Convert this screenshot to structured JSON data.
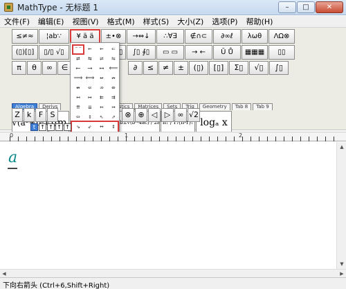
{
  "window": {
    "title": "MathType - 无标题 1",
    "buttons": {
      "minimize": "–",
      "maximize": "□",
      "close": "✕"
    }
  },
  "menu": [
    "文件(F)",
    "编辑(E)",
    "视图(V)",
    "格式(M)",
    "样式(S)",
    "大小(Z)",
    "选项(P)",
    "帮助(H)"
  ],
  "toolbar_row1": [
    "≤≠≈",
    "¦ab∵",
    "¥ ä ä",
    "±•⊗",
    "→⇔↓",
    "∴∀∃",
    "∉∩⊂",
    "∂∞ℓ",
    "λωθ",
    "ΛΩ⊗"
  ],
  "toolbar_row2": [
    "(▯)[▯]",
    "▯/▯ √▯",
    "▯ ▯",
    "Σ▯ Σ▯",
    "∫▯ ∮▯",
    "▭ ▭",
    "→ ←",
    "Ū Ů",
    "▦▦▦",
    "▯▯"
  ],
  "toolbar_row3": [
    "π",
    "θ",
    "∞",
    "∈",
    "∂",
    "≤",
    "≠",
    "±",
    "(▯)",
    "[▯]",
    "Σ▯",
    "√▯",
    "∫▯"
  ],
  "tabs": [
    "Algebra",
    "Derivs",
    "Statistics",
    "Matrices",
    "Sets",
    "Trig",
    "Geometry",
    "Tab 8",
    "Tab 9"
  ],
  "templates": [
    "√(a²+b²)",
    "lim",
    "-b±√(b²-4ac) / 2a",
    "n! / r!(n-r)!",
    "logₐ x"
  ],
  "row4": [
    "Z",
    "k",
    "F",
    "S"
  ],
  "row4b": [
    "⊗",
    "⊕",
    "◁",
    "▷",
    "∞",
    "√2"
  ],
  "dropdown_cells": [
    "⁻⁻",
    "←",
    "←",
    "⇐",
    "⇄",
    "⇆",
    "⇌",
    "⇋",
    "⟵",
    "⟶",
    "⟷",
    "⟸",
    "⟹",
    "⟺",
    "↚",
    "↛",
    "↮",
    "⇍",
    "⇏",
    "⇎",
    "↤",
    "↦",
    "⇇",
    "⇉",
    "⇈",
    "⇊",
    "↢",
    "↣",
    "⇔",
    "⇕",
    "⇖",
    "⇗",
    "⇘",
    "⇙",
    "↔",
    "↕",
    "↰",
    "↱",
    "↲",
    "↳"
  ],
  "size_buttons": [
    "t",
    "↑",
    "↑",
    "↑",
    "↑"
  ],
  "ruler": {
    "zero": "0",
    "one": "1",
    "two": "2"
  },
  "equation": "a",
  "status": "下向右箭头 (Ctrl+6,Shift+Right)"
}
